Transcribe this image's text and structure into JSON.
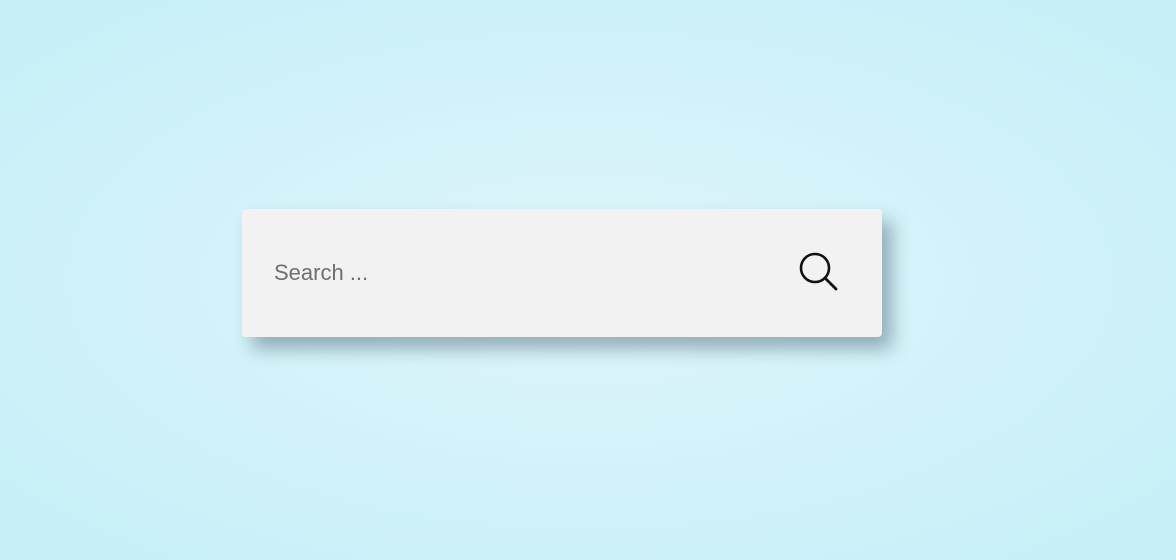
{
  "search": {
    "placeholder": "Search ...",
    "value": "",
    "button_icon": "search-icon"
  },
  "colors": {
    "background": "#d4f3fa",
    "box": "#f2f2f2",
    "placeholder": "#6f6f6f",
    "icon": "#111111"
  }
}
